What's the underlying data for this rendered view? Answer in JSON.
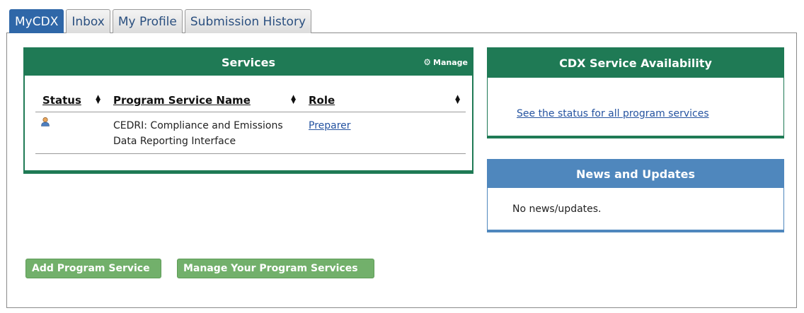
{
  "tabs": [
    {
      "label": "MyCDX",
      "active": true
    },
    {
      "label": "Inbox",
      "active": false
    },
    {
      "label": "My Profile",
      "active": false
    },
    {
      "label": "Submission History",
      "active": false
    }
  ],
  "services": {
    "title": "Services",
    "manage_label": "Manage",
    "columns": [
      "Status",
      "Program Service Name",
      "Role"
    ],
    "rows": [
      {
        "status_icon": "user-icon",
        "name": "CEDRI: Compliance and Emissions Data Reporting Interface",
        "role": "Preparer"
      }
    ]
  },
  "availability": {
    "title": "CDX Service Availability",
    "link": "See the status for all program services"
  },
  "news": {
    "title": "News and Updates",
    "body": "No news/updates."
  },
  "buttons": {
    "add": "Add Program Service",
    "manage": "Manage Your Program Services"
  },
  "colors": {
    "tab_active": "#2f67a8",
    "services_green": "#1f7a55",
    "news_blue": "#4f87bd",
    "button_green": "#72b06b",
    "link": "#2553a0"
  }
}
